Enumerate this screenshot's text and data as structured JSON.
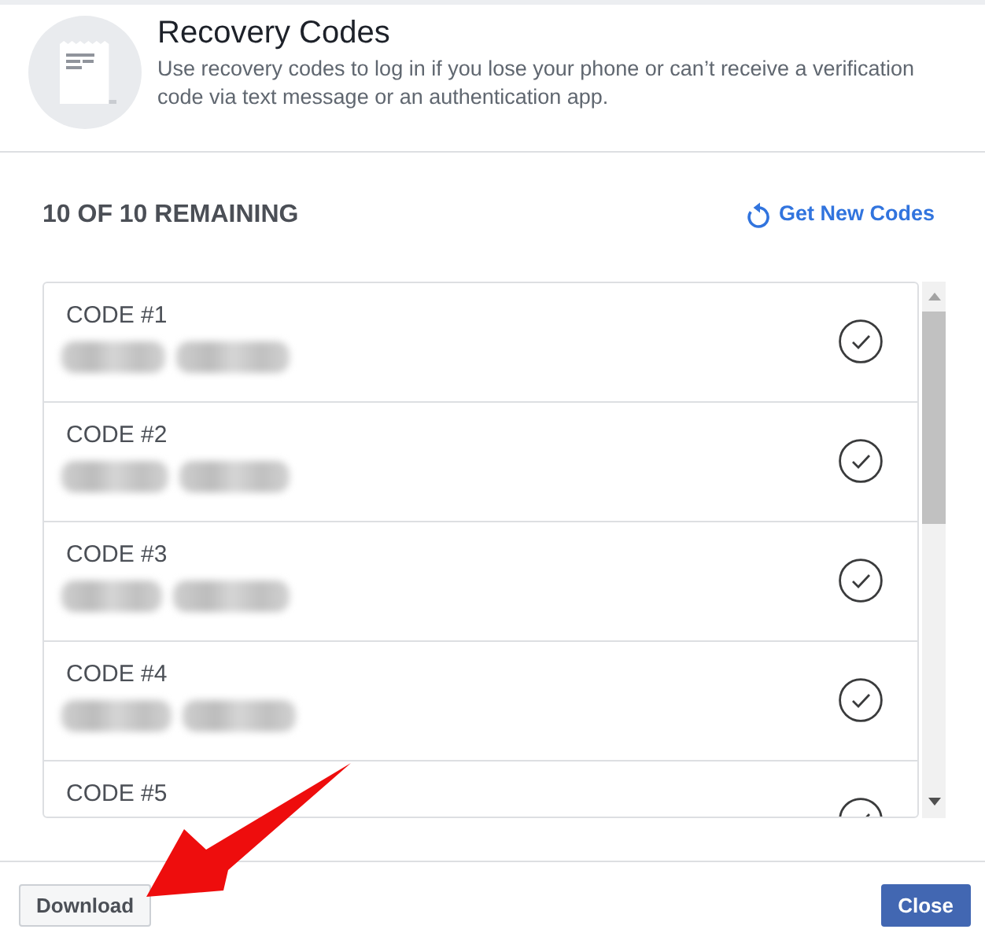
{
  "header": {
    "title": "Recovery Codes",
    "description": "Use recovery codes to log in if you lose your phone or can’t receive a verification code via text message or an authentication app."
  },
  "summary": {
    "remaining": "10 OF 10 REMAINING",
    "link": "Get New Codes"
  },
  "codes": [
    {
      "label": "CODE #1",
      "checked": true
    },
    {
      "label": "CODE #2",
      "checked": true
    },
    {
      "label": "CODE #3",
      "checked": true
    },
    {
      "label": "CODE #4",
      "checked": true
    },
    {
      "label": "CODE #5",
      "checked": true
    }
  ],
  "footer": {
    "buttons": [
      {
        "label": "Download",
        "kind": "secondary"
      },
      {
        "label": "Close",
        "kind": "primary"
      }
    ]
  }
}
